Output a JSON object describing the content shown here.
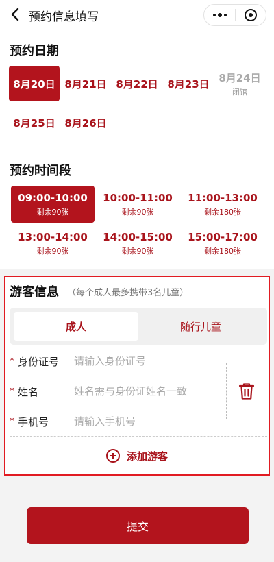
{
  "nav": {
    "title": "预约信息填写",
    "back_icon": "chevron-left-icon",
    "more_icon": "more-dots-icon",
    "close_icon": "target-circle-icon"
  },
  "date_section": {
    "title": "预约日期",
    "dates": [
      {
        "label": "8月20日",
        "sub": "",
        "state": "selected"
      },
      {
        "label": "8月21日",
        "sub": "",
        "state": "available"
      },
      {
        "label": "8月22日",
        "sub": "",
        "state": "available"
      },
      {
        "label": "8月23日",
        "sub": "",
        "state": "available"
      },
      {
        "label": "8月24日",
        "sub": "闭馆",
        "state": "disabled"
      },
      {
        "label": "8月25日",
        "sub": "",
        "state": "available"
      },
      {
        "label": "8月26日",
        "sub": "",
        "state": "available"
      }
    ]
  },
  "time_section": {
    "title": "预约时间段",
    "slots": [
      {
        "time": "09:00-10:00",
        "remain": "剩余90张",
        "state": "selected"
      },
      {
        "time": "10:00-11:00",
        "remain": "剩余90张",
        "state": "available"
      },
      {
        "time": "11:00-13:00",
        "remain": "剩余180张",
        "state": "available"
      },
      {
        "time": "13:00-14:00",
        "remain": "剩余90张",
        "state": "available"
      },
      {
        "time": "14:00-15:00",
        "remain": "剩余90张",
        "state": "available"
      },
      {
        "time": "15:00-17:00",
        "remain": "剩余180张",
        "state": "available"
      }
    ]
  },
  "visitor": {
    "title": "游客信息",
    "hint": "（每个成人最多携带3名儿童）",
    "tabs": [
      "成人",
      "随行儿童"
    ],
    "fields": [
      {
        "required": "*",
        "label": "身份证号",
        "placeholder": "请输入身份证号"
      },
      {
        "required": "*",
        "label": "姓名",
        "placeholder": "姓名需与身份证姓名一致"
      },
      {
        "required": "*",
        "label": "手机号",
        "placeholder": "请输入手机号"
      }
    ],
    "delete_icon": "trash-icon",
    "add_label": "添加游客",
    "add_icon": "plus-circle-icon"
  },
  "submit_label": "提交",
  "colors": {
    "accent": "#b3141d",
    "highlight_border": "#e11b22"
  }
}
